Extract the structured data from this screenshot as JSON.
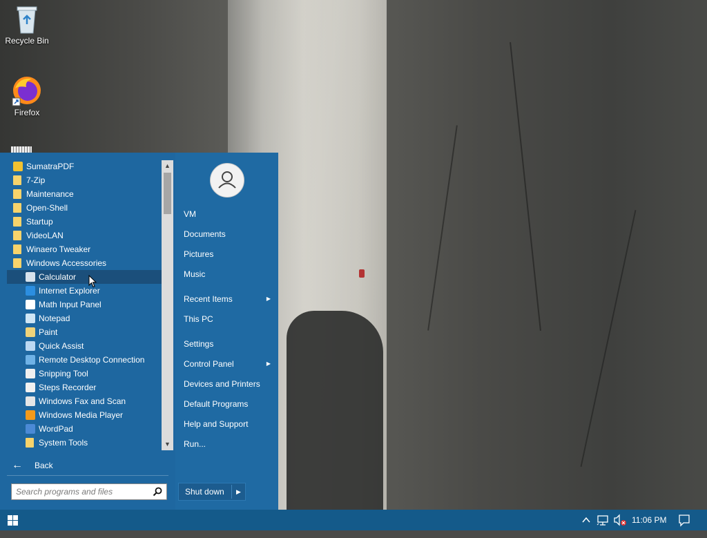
{
  "desktop": {
    "icons": [
      {
        "label": "Recycle Bin",
        "icon": "recycle-bin-icon"
      },
      {
        "label": "Firefox",
        "icon": "firefox-icon"
      }
    ]
  },
  "start_menu": {
    "programs": [
      {
        "label": "SumatraPDF",
        "icon": "sumatrapdf-icon",
        "level": 0
      },
      {
        "label": "7-Zip",
        "icon": "folder-icon",
        "level": 0
      },
      {
        "label": "Maintenance",
        "icon": "folder-icon",
        "level": 0
      },
      {
        "label": "Open-Shell",
        "icon": "folder-icon",
        "level": 0
      },
      {
        "label": "Startup",
        "icon": "folder-icon",
        "level": 0
      },
      {
        "label": "VideoLAN",
        "icon": "folder-icon",
        "level": 0
      },
      {
        "label": "Winaero Tweaker",
        "icon": "folder-icon",
        "level": 0
      },
      {
        "label": "Windows Accessories",
        "icon": "folder-icon",
        "level": 0
      },
      {
        "label": "Calculator",
        "icon": "calculator-icon",
        "level": 1,
        "hover": true
      },
      {
        "label": "Internet Explorer",
        "icon": "internet-explorer-icon",
        "level": 1
      },
      {
        "label": "Math Input Panel",
        "icon": "math-input-panel-icon",
        "level": 1
      },
      {
        "label": "Notepad",
        "icon": "notepad-icon",
        "level": 1
      },
      {
        "label": "Paint",
        "icon": "paint-icon",
        "level": 1
      },
      {
        "label": "Quick Assist",
        "icon": "quick-assist-icon",
        "level": 1
      },
      {
        "label": "Remote Desktop Connection",
        "icon": "remote-desktop-icon",
        "level": 1
      },
      {
        "label": "Snipping Tool",
        "icon": "snipping-tool-icon",
        "level": 1
      },
      {
        "label": "Steps Recorder",
        "icon": "steps-recorder-icon",
        "level": 1
      },
      {
        "label": "Windows Fax and Scan",
        "icon": "fax-scan-icon",
        "level": 1
      },
      {
        "label": "Windows Media Player",
        "icon": "media-player-icon",
        "level": 1
      },
      {
        "label": "WordPad",
        "icon": "wordpad-icon",
        "level": 1
      },
      {
        "label": "System Tools",
        "icon": "folder-icon",
        "level": 1
      }
    ],
    "back_label": "Back",
    "search_placeholder": "Search programs and files",
    "right_items": [
      {
        "label": "VM",
        "has_submenu": false
      },
      {
        "label": "Documents",
        "has_submenu": false
      },
      {
        "label": "Pictures",
        "has_submenu": false
      },
      {
        "label": "Music",
        "has_submenu": false
      },
      {
        "label": "Recent Items",
        "has_submenu": true
      },
      {
        "label": "This PC",
        "has_submenu": false
      },
      {
        "label": "Settings",
        "has_submenu": false
      },
      {
        "label": "Control Panel",
        "has_submenu": true
      },
      {
        "label": "Devices and Printers",
        "has_submenu": false
      },
      {
        "label": "Default Programs",
        "has_submenu": false
      },
      {
        "label": "Help and Support",
        "has_submenu": false
      },
      {
        "label": "Run...",
        "has_submenu": false
      }
    ],
    "shutdown_label": "Shut down"
  },
  "taskbar": {
    "clock": "11:06 PM"
  },
  "colors": {
    "menu_bg": "#1f6aa3",
    "menu_hover": "#1b4f7b",
    "taskbar_bg": "#145a8a",
    "folder": "#f7d36b"
  }
}
